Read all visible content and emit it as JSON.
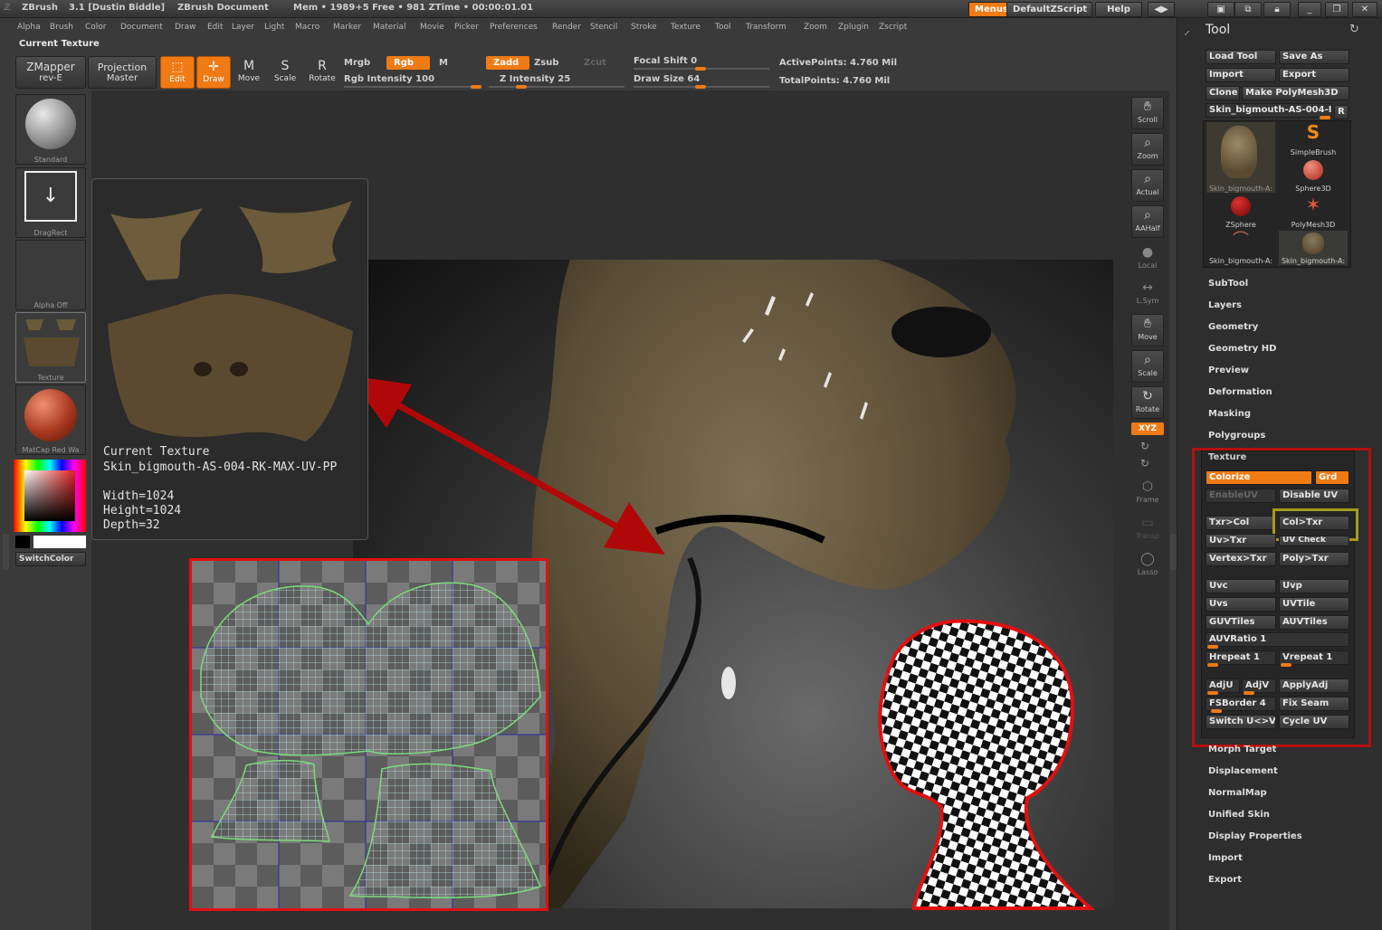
{
  "titlebar": {
    "app": "ZBrush",
    "version": "3.1 [Dustin Biddle]",
    "document": "ZBrush Document",
    "stats": "Mem • 1989+5  Free • 981  ZTime • 00:00:01.01",
    "menus_btn": "Menus",
    "script_btn": "DefaultZScript",
    "help_btn": "Help"
  },
  "menubar": [
    "Alpha",
    "Brush",
    "Color",
    "Document",
    "Draw",
    "Edit",
    "Layer",
    "Light",
    "Macro",
    "Marker",
    "Material",
    "Movie",
    "Picker",
    "Preferences",
    "Render",
    "Stencil",
    "Stroke",
    "Texture",
    "Tool",
    "Transform",
    "Zoom",
    "Zplugin",
    "Zscript"
  ],
  "current_texture_label": "Current Texture",
  "toolbar": {
    "zmapper": "ZMapper",
    "zmapper_sub": "rev-E",
    "projection": "Projection",
    "projection_sub": "Master",
    "edit": "Edit",
    "draw": "Draw",
    "move": "Move",
    "scale": "Scale",
    "rotate": "Rotate",
    "mrgb": "Mrgb",
    "rgb": "Rgb",
    "m": "M",
    "rgb_intensity": "Rgb  Intensity 100",
    "zadd": "Zadd",
    "zsub": "Zsub",
    "zcut": "Zcut",
    "z_intensity": "Z  Intensity 25",
    "focal_shift": "Focal Shift 0",
    "draw_size": "Draw Size 64",
    "active_points": "ActivePoints: 4.760  Mil",
    "total_points": "TotalPoints: 4.760  Mil"
  },
  "shelf": {
    "standard": "Standard",
    "dragrect": "DragRect",
    "alpha_off": "Alpha  Off",
    "texture": "Texture",
    "matcap": "MatCap  Red  Wa",
    "switchcolor": "SwitchColor"
  },
  "popup": {
    "title": "Current Texture",
    "name": "Skin_bigmouth-AS-004-RK-MAX-UV-PP",
    "width": "Width=1024",
    "height": "Height=1024",
    "depth": "Depth=32"
  },
  "strip": {
    "scroll": "Scroll",
    "zoom": "Zoom",
    "actual": "Actual",
    "aahalf": "AAHalf",
    "local": "Local",
    "lsym": "L.Sym",
    "move": "Move",
    "scale": "Scale",
    "rotate": "Rotate",
    "xyz": "XYZ",
    "frame": "Frame",
    "transp": "Transp",
    "lasso": "Lasso"
  },
  "tool_panel": {
    "title": "Tool",
    "load_tool": "Load Tool",
    "save_as": "Save As",
    "import": "Import",
    "export": "Export",
    "clone": "Clone",
    "make_polymesh": "Make PolyMesh3D",
    "current_tool": "Skin_bigmouth-AS-004-I",
    "r": "R",
    "thumbs": [
      "Skin_bigmouth-A:",
      "SimpleBrush",
      "Sphere3D",
      "ZSphere",
      "PolyMesh3D",
      "Skin_bigmouth-A:",
      "Skin_bigmouth-A:"
    ],
    "sections_top": [
      "SubTool",
      "Layers",
      "Geometry",
      "Geometry HD",
      "Preview",
      "Deformation",
      "Masking",
      "Polygroups"
    ],
    "texture_header": "Texture",
    "texture_buttons": {
      "colorize": "Colorize",
      "grd": "Grd",
      "enableuv": "EnableUV",
      "disableuv": "Disable UV",
      "txr_col": "Txr>Col",
      "col_txr": "Col>Txr",
      "uv_txr": "Uv>Txr",
      "uv_check": "UV Check",
      "vertex_txr": "Vertex>Txr",
      "poly_txr": "Poly>Txr",
      "uvc": "Uvc",
      "uvp": "Uvp",
      "uvs": "Uvs",
      "uvtile": "UVTile",
      "guvtiles": "GUVTiles",
      "auvtiles": "AUVTiles",
      "auvratio": "AUVRatio 1",
      "hrepeat": "Hrepeat 1",
      "vrepeat": "Vrepeat 1",
      "adju": "AdjU",
      "adjv": "AdjV",
      "applyadj": "ApplyAdj",
      "fsborder": "FSBorder 4",
      "fix_seam": "Fix Seam",
      "switch_uv": "Switch U<>V",
      "cycle_uv": "Cycle UV"
    },
    "sections_bottom": [
      "Morph Target",
      "Displacement",
      "NormalMap",
      "Unified Skin",
      "Display Properties",
      "Import",
      "Export"
    ]
  },
  "colors": {
    "accent": "#f07a14",
    "highlight_red": "#e01010",
    "highlight_olive": "#a89a1a",
    "arrow": "#b00808"
  }
}
